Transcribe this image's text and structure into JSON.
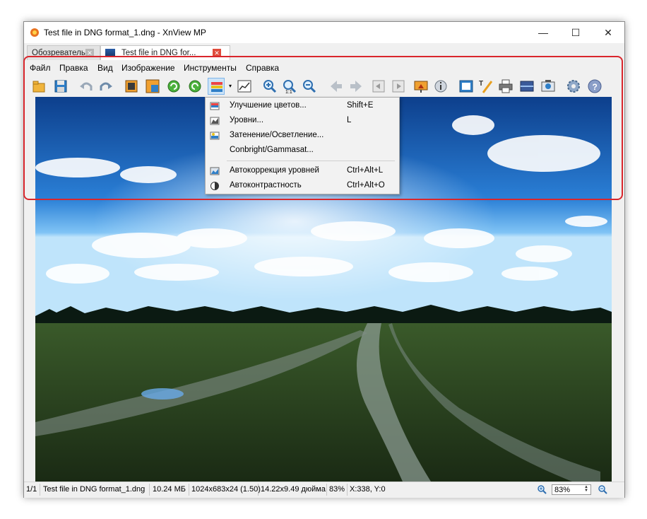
{
  "window": {
    "title": "Test file in DNG format_1.dng - XnView MP",
    "minimize": "—",
    "maximize": "☐",
    "close": "✕"
  },
  "tabs": [
    {
      "label": "Обозреватель",
      "close": "✕"
    },
    {
      "label": "Test file in DNG for...",
      "close": "✕"
    }
  ],
  "menu": [
    "Файл",
    "Правка",
    "Вид",
    "Изображение",
    "Инструменты",
    "Справка"
  ],
  "toolbar": {
    "icons": [
      "open-folder-icon",
      "save-icon",
      "undo-icon",
      "redo-icon",
      "crop-icon",
      "resize-icon",
      "rotate-left-icon",
      "rotate-right-icon",
      "color-adjust-icon",
      "histogram-icon",
      "zoom-in-icon",
      "zoom-fit-icon",
      "zoom-out-icon",
      "prev-icon",
      "next-icon",
      "first-icon",
      "last-icon",
      "slideshow-icon",
      "info-icon",
      "fullscreen-icon",
      "edit-text-icon",
      "print-icon",
      "scan-icon",
      "capture-icon",
      "settings-icon",
      "help-icon"
    ],
    "dropdown_arrow": "▾"
  },
  "dropdown": {
    "items": [
      {
        "label": "Улучшение цветов...",
        "shortcut": "Shift+E",
        "icon": "color-enhance-icon"
      },
      {
        "label": "Уровни...",
        "shortcut": "L",
        "icon": "levels-icon"
      },
      {
        "label": "Затенение/Осветление...",
        "shortcut": "",
        "icon": "shadow-highlight-icon"
      },
      {
        "label": "Conbright/Gammasat...",
        "shortcut": "",
        "icon": ""
      },
      {
        "label": "Автокоррекция уровней",
        "shortcut": "Ctrl+Alt+L",
        "icon": "auto-levels-icon"
      },
      {
        "label": "Автоконтрастность",
        "shortcut": "Ctrl+Alt+O",
        "icon": "auto-contrast-icon"
      }
    ]
  },
  "status": {
    "page": "1/1",
    "filename": "Test file in DNG format_1.dng",
    "filesize": "10.24 МБ",
    "dimensions": "1024x683x24 (1.50)",
    "print_size": "14.22x9.49 дюйма",
    "zoom_percent": "83%",
    "coords": "X:338, Y:0",
    "zoom_value": "83%"
  },
  "colors": {
    "highlight": "#d9262c",
    "accent": "#3c8ad6"
  }
}
